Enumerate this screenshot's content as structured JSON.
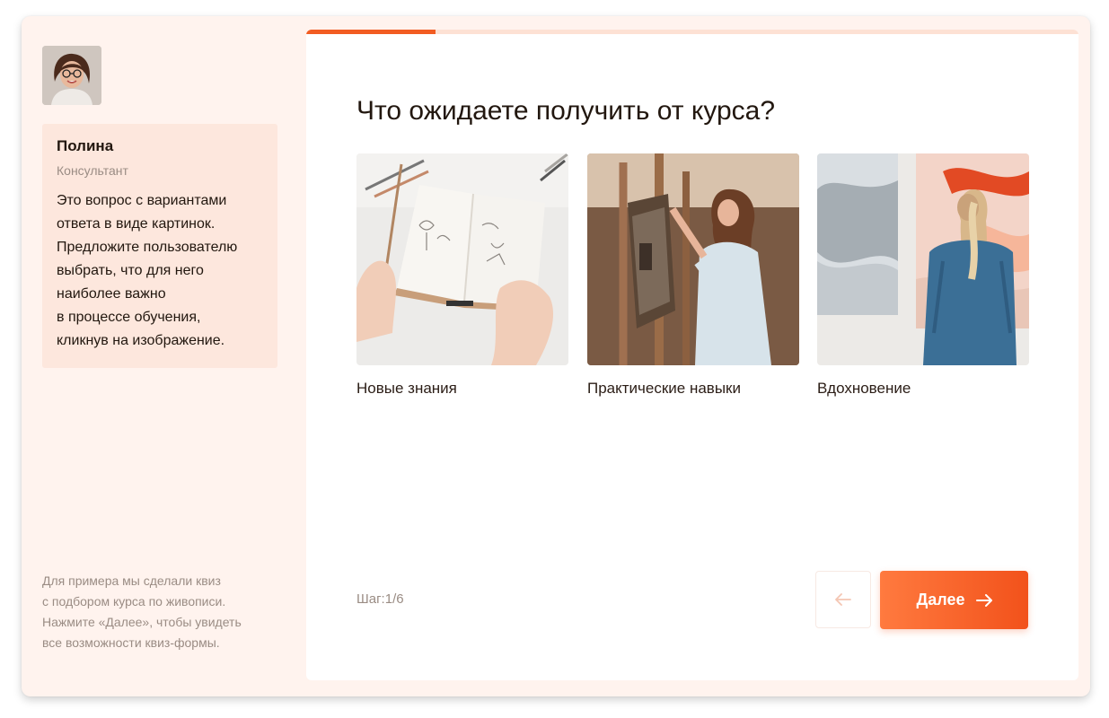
{
  "consultant": {
    "name": "Полина",
    "role": "Консультант",
    "message": "Это вопрос с вариантами\nответа в виде картинок.\nПредложите пользователю\nвыбрать, что для него\nнаиболее важно\nв процессе обучения,\nкликнув на изображение."
  },
  "sidebar_note": "Для примера мы сделали квиз\nс подбором курса по живописи.\nНажмите «Далее», чтобы увидеть\nвсе возможности квиз-формы.",
  "progress": {
    "fraction": 0.167
  },
  "question": "Что ожидаете получить от курса?",
  "options": [
    {
      "label": "Новые знания",
      "image": "sketchbook-drawing-photo"
    },
    {
      "label": "Практические навыки",
      "image": "woman-painting-easel-photo"
    },
    {
      "label": "Вдохновение",
      "image": "woman-viewing-art-photo"
    }
  ],
  "footer": {
    "step": "Шаг:1/6",
    "next_label": "Далее",
    "back_icon": "arrow-left-icon",
    "next_icon": "arrow-right-icon"
  },
  "colors": {
    "accent": "#f25c22",
    "sidebar_bg": "#fff3ee",
    "bubble_bg": "#fde7dd"
  }
}
